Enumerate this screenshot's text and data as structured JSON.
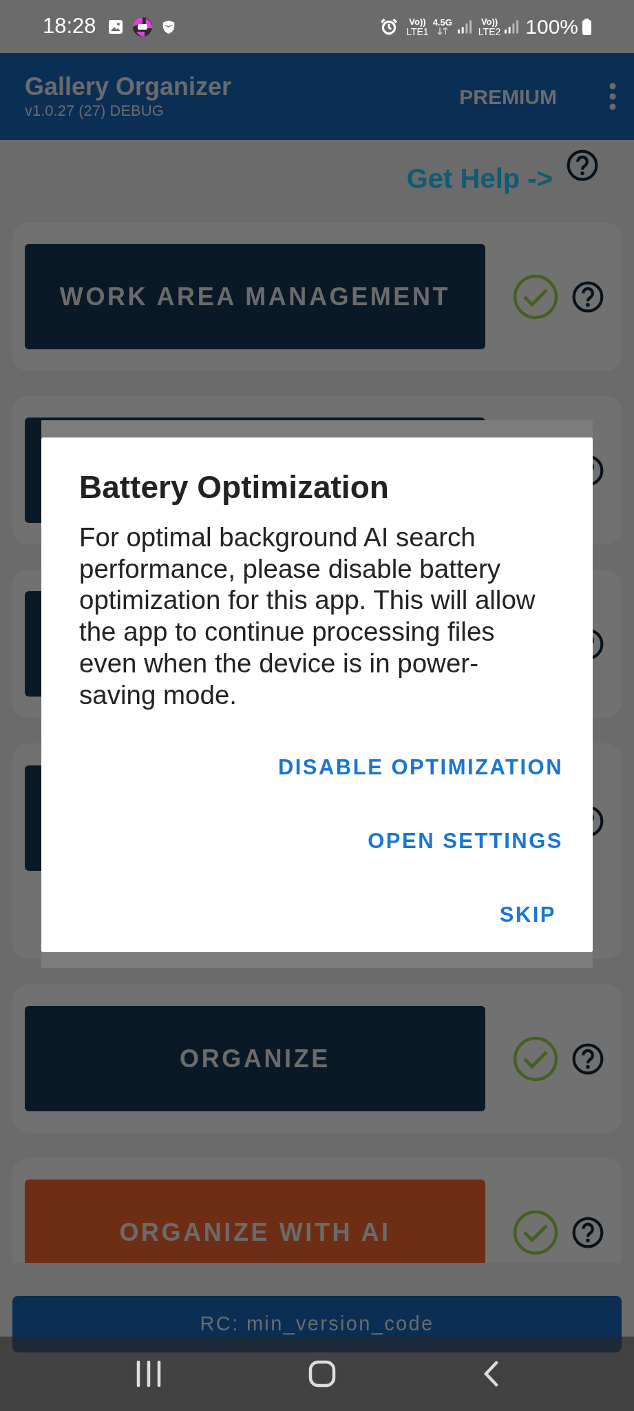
{
  "status_bar": {
    "time": "18:28",
    "sim1_voice": "Vo))",
    "sim1_label": "LTE1",
    "network_type": "4.5G",
    "sim2_voice": "Vo))",
    "sim2_label": "LTE2",
    "battery": "100%"
  },
  "app_bar": {
    "title": "Gallery Organizer",
    "subtitle": "v1.0.27 (27) DEBUG",
    "action": "PREMIUM"
  },
  "help_link": "Get Help ->",
  "cards": [
    {
      "kind": "dark",
      "label": "WORK AREA MANAGEMENT",
      "done": true
    },
    {
      "kind": "dark"
    },
    {
      "kind": "dark"
    },
    {
      "kind": "dark",
      "expanded": true
    },
    {
      "kind": "dark",
      "label": "ORGANIZE",
      "done": true
    },
    {
      "kind": "accent",
      "label": "ORGANIZE WITH AI",
      "done": true
    }
  ],
  "remote_config_bar": "RC: min_version_code",
  "dialog": {
    "title": "Battery Optimization",
    "message": "For optimal background AI search performance, please disable battery optimization for this app. This will allow the app to continue processing files even when the device is in power-saving mode.",
    "actions": [
      "DISABLE OPTIMIZATION",
      "OPEN SETTINGS",
      "SKIP"
    ]
  }
}
